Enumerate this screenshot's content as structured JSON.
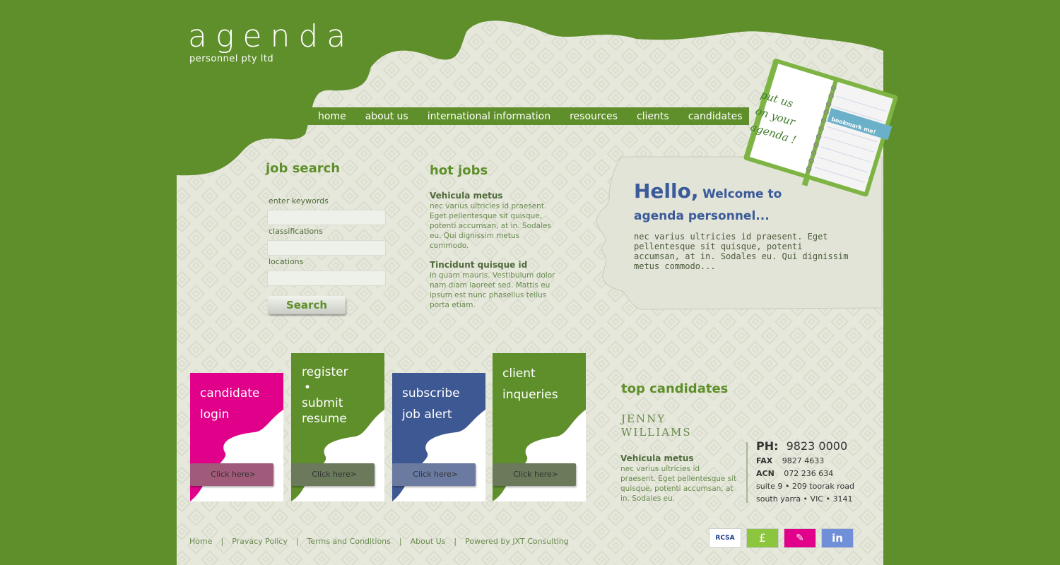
{
  "brand": {
    "name": "agenda",
    "tagline": "personnel pty ltd"
  },
  "nav": [
    "home",
    "about us",
    "international information",
    "resources",
    "clients",
    "candidates"
  ],
  "bookmark": {
    "note_lines": [
      "put us",
      "on your",
      "agenda !"
    ],
    "tab": "bookmark me!"
  },
  "job_search": {
    "title": "job search",
    "keywords_label": "enter keywords",
    "classifications_label": "classifications",
    "locations_label": "locations",
    "button": "Search"
  },
  "hot_jobs": {
    "title": "hot jobs",
    "items": [
      {
        "title": "Vehicula metus",
        "desc": "nec varius ultricies id praesent. Eget pellentesque sit quisque, potenti accumsan, at in. Sodales eu. Qui dignissim metus commodo."
      },
      {
        "title": "Tincidunt quisque id",
        "desc": "in quam mauris. Vestibulum dolor nam diam laoreet sed. Mattis eu ipsum est nunc phasellus tellus porta etiam."
      }
    ]
  },
  "welcome": {
    "hello": "Hello,",
    "welcome_to": "Welcome to",
    "company": "agenda personnel...",
    "body": "nec varius ultricies id praesent. Eget pellentesque sit quisque, potenti accumsan, at in. Sodales eu. Qui dignissim metus commodo..."
  },
  "cards": [
    {
      "lines": [
        "candidate",
        "login"
      ],
      "button": "Click here>",
      "color": "#e0008a"
    },
    {
      "lines": [
        "register",
        "•",
        "submit",
        "resume"
      ],
      "button": "Click here>",
      "color": "#5f8f2a"
    },
    {
      "lines": [
        "subscribe",
        "job alert"
      ],
      "button": "Click here>",
      "color": "#3e5894"
    },
    {
      "lines": [
        "client",
        "inqueries"
      ],
      "button": "Click here>",
      "color": "#5f8f2a"
    }
  ],
  "top_candidates": {
    "title": "top candidates",
    "name": "JENNY WILLIAMS",
    "job_title": "Vehicula metus",
    "desc": "nec varius ultricies id praesent. Eget pellentesque sit quisque, potenti accumsan, at in. Sodales eu."
  },
  "contact": {
    "ph_label": "PH:",
    "ph": "9823 0000",
    "fax_label": "FAX",
    "fax": "9827 4633",
    "acn_label": "ACN",
    "acn": "072 236 634",
    "address1": "suite 9 • 209 toorak road",
    "address2": "south yarra • VIC • 3141"
  },
  "footer": {
    "links": [
      "Home",
      "Pravacy Policy",
      "Terms and Conditions",
      "About Us",
      "Powered by JXT Consulting"
    ],
    "separator": "|"
  },
  "badges": [
    {
      "label": "RCSA",
      "color": "#ffffff",
      "text_color": "#1a3a8a"
    },
    {
      "label": "£",
      "color": "#8cc63f",
      "text_color": "#ffffff"
    },
    {
      "label": "✎",
      "color": "#e0008a",
      "text_color": "#ffffff"
    },
    {
      "label": "in",
      "color": "#6f8fd8",
      "text_color": "#ffffff"
    }
  ]
}
